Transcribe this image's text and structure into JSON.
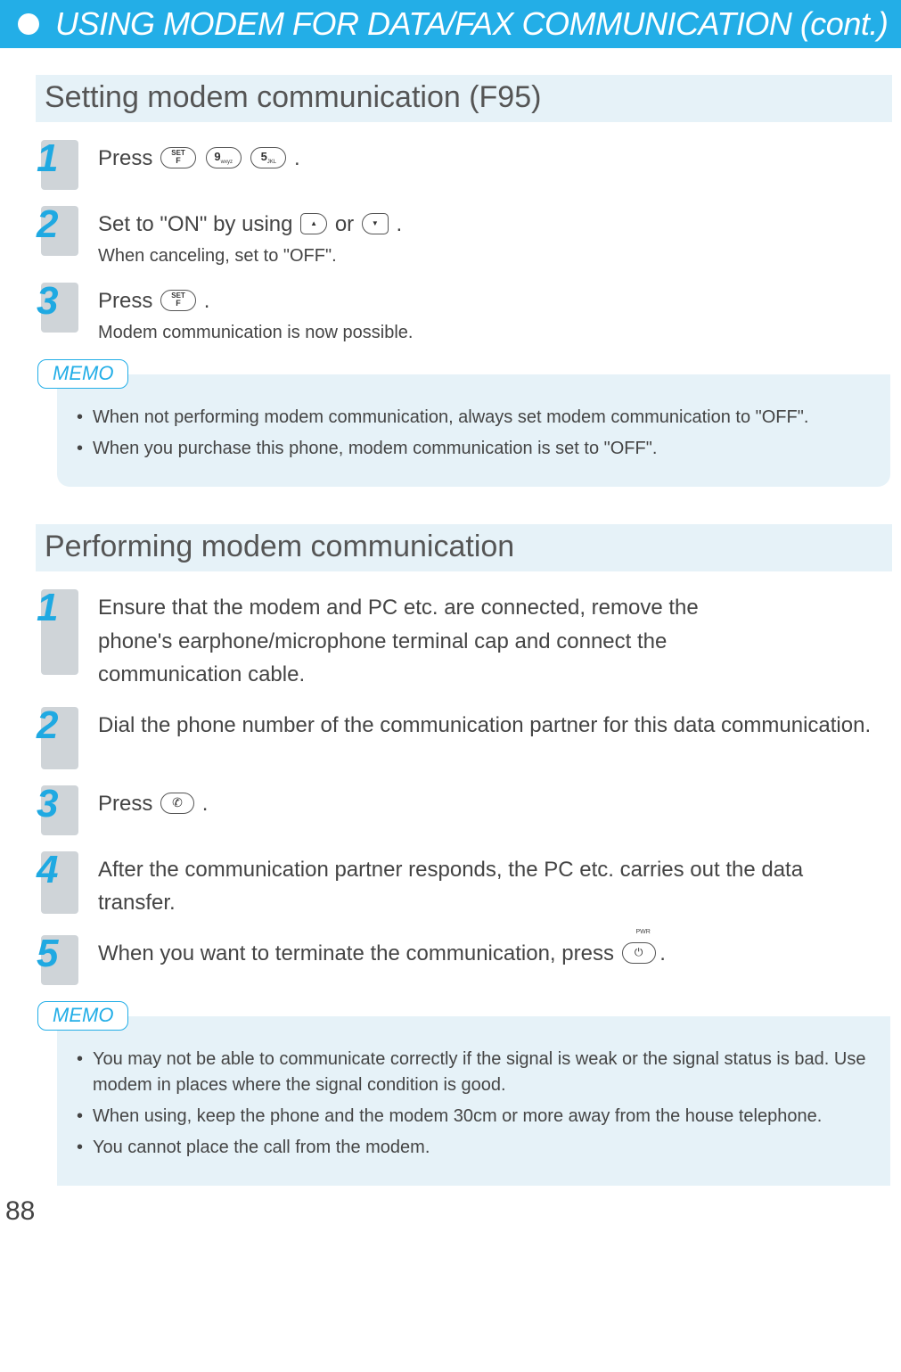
{
  "header": {
    "title": "USING MODEM FOR DATA/FAX COMMUNICATION (cont.)"
  },
  "section1": {
    "title": "Setting modem communication (F95)",
    "steps": {
      "s1": {
        "num": "1",
        "main_a": "Press ",
        "main_b": "."
      },
      "s2": {
        "num": "2",
        "main_a": "Set to \"ON\" by using ",
        "main_or": " or ",
        "main_b": ".",
        "sub": "When canceling, set to \"OFF\"."
      },
      "s3": {
        "num": "3",
        "main_a": "Press ",
        "main_b": ".",
        "sub": "Modem communication is now possible."
      }
    },
    "memo_label": "MEMO",
    "memo": [
      "When not performing modem communication, always set modem communication to \"OFF\".",
      "When you purchase this phone, modem communication is set to \"OFF\"."
    ]
  },
  "section2": {
    "title": "Performing modem communication",
    "steps": {
      "s1": {
        "num": "1",
        "main": "Ensure that the modem and PC etc. are connected, remove the phone's earphone/microphone terminal cap and connect the communication cable."
      },
      "s2": {
        "num": "2",
        "main": "Dial the phone number of the communication partner for this data communication."
      },
      "s3": {
        "num": "3",
        "main_a": "Press ",
        "main_b": "."
      },
      "s4": {
        "num": "4",
        "main": "After the communication partner responds, the PC etc. carries out the data transfer."
      },
      "s5": {
        "num": "5",
        "main_a": "When you want to terminate the communication, press ",
        "main_b": "."
      }
    },
    "memo_label": "MEMO",
    "memo": [
      "You may not be able to communicate correctly if the signal is weak or the signal status is bad. Use modem in places where the signal condition is good.",
      "When using, keep the phone and the modem 30cm or more away from the house telephone.",
      "You cannot place the call from the modem."
    ]
  },
  "page_number": "88",
  "keys": {
    "set_top": "SET",
    "set_bottom": "F",
    "pwr": "PWR"
  }
}
